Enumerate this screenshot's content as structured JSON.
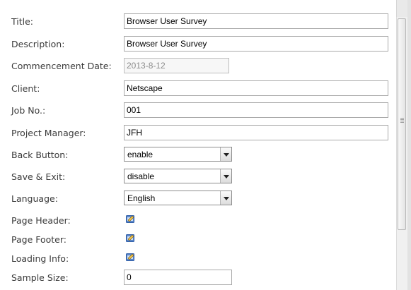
{
  "form": {
    "title": {
      "label": "Title:",
      "value": "Browser User Survey"
    },
    "description": {
      "label": "Description:",
      "value": "Browser User Survey"
    },
    "commencement_date": {
      "label": "Commencement Date:",
      "value": "2013-8-12"
    },
    "client": {
      "label": "Client:",
      "value": "Netscape"
    },
    "job_no": {
      "label": "Job No.:",
      "value": "001"
    },
    "project_manager": {
      "label": "Project Manager:",
      "value": "JFH"
    },
    "back_button": {
      "label": "Back Button:",
      "selected": "enable"
    },
    "save_exit": {
      "label": "Save & Exit:",
      "selected": "disable"
    },
    "language": {
      "label": "Language:",
      "selected": "English"
    },
    "page_header": {
      "label": "Page Header:",
      "icon": "edit-icon"
    },
    "page_footer": {
      "label": "Page Footer:",
      "icon": "edit-icon"
    },
    "loading_info": {
      "label": "Loading Info:",
      "icon": "edit-icon"
    },
    "sample_size": {
      "label": "Sample Size:",
      "value": "0"
    }
  }
}
